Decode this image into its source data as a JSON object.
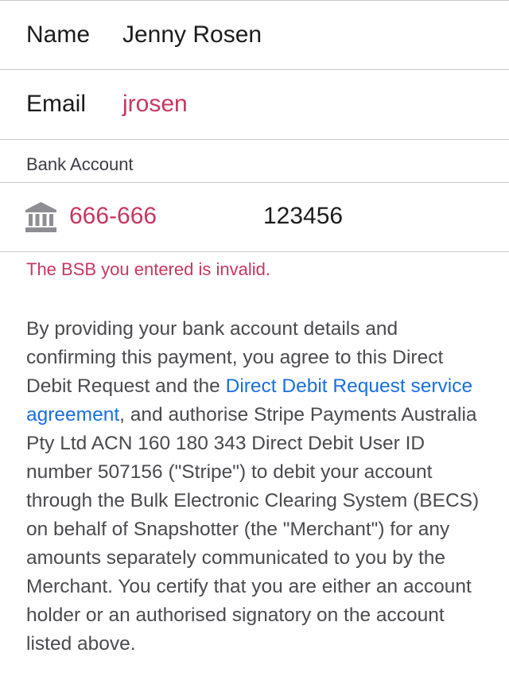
{
  "form": {
    "name": {
      "label": "Name",
      "value": "Jenny Rosen"
    },
    "email": {
      "label": "Email",
      "value": "jrosen"
    },
    "bank_account": {
      "section_header": "Bank Account",
      "icon": "bank-icon",
      "bsb": "666-666",
      "account_number": "123456",
      "error": "The BSB you entered is invalid."
    }
  },
  "mandate": {
    "text_before_link": "By providing your bank account details and confirming this payment, you agree to this Direct Debit Request and the ",
    "link_text": "Direct Debit Request service agreement",
    "text_after_link": ", and authorise Stripe Payments Australia Pty Ltd ACN 160 180 343 Direct Debit User ID number 507156 (\"Stripe\") to debit your account through the Bulk Electronic Clearing System (BECS) on behalf of Snapshotter (the \"Merchant\") for any amounts separately communicated to you by the Merchant. You certify that you are either an account holder or an authorised signatory on the account listed above."
  },
  "colors": {
    "invalid_text": "#c7375f",
    "link": "#1a6fe0",
    "separator": "#c8c7cc"
  }
}
